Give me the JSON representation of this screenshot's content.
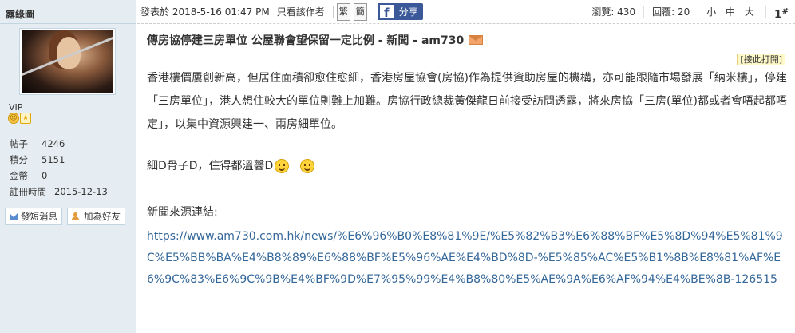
{
  "user": {
    "name": "露綠圖",
    "group": "VIP",
    "stats": [
      {
        "label": "帖子",
        "value": "4246"
      },
      {
        "label": "積分",
        "value": "5151"
      },
      {
        "label": "金幣",
        "value": "0"
      },
      {
        "label": "註冊時間",
        "value": "2015-12-13"
      }
    ],
    "buttons": {
      "message": "發短消息",
      "add_friend": "加為好友"
    }
  },
  "post_meta": {
    "posted": "發表於 2018-5-16 01:47 PM",
    "only_author": "只看該作者",
    "trad": "繁",
    "simp": "簡",
    "share": "分享",
    "share_logo": "f",
    "views": "瀏覽: 430",
    "replies": "回覆: 20",
    "font_sizes": "小 中 大",
    "floor_num": "1",
    "floor_mark": "#"
  },
  "post": {
    "title": "傳房協停建三房單位 公屋聯會望保留一定比例 - 新聞 - am730",
    "print": "[接此打開]",
    "paragraph": "香港樓價屢創新高，但居住面積卻愈住愈細，香港房屋協會(房協)作為提供資助房屋的機構，亦可能跟隨市場發展「納米樓」，停建「三房單位」，港人想住較大的單位則難上加難。房協行政總裁黃傑龍日前接受訪問透露，將來房協「三房(單位)都或者會唔起都唔定」，以集中資源興建一、兩房細單位。",
    "comment": "細D骨子D，住得都溫馨D",
    "source_label": "新聞來源連結:",
    "source_link": "https://www.am730.com.hk/news/%E6%96%B0%E8%81%9E/%E5%82%B3%E6%88%BF%E5%8D%94%E5%81%9C%E5%BB%BA%E4%B8%89%E6%88%BF%E5%96%AE%E4%BD%8D-%E5%85%AC%E5%B1%8B%E8%81%AF%E6%9C%83%E6%9C%9B%E4%BF%9D%E7%95%99%E4%B8%80%E5%AE%9A%E6%AF%94%E4%BE%8B-126515"
  },
  "colors": {
    "sidebar_bg": "#e5edf2",
    "link": "#336699",
    "facebook": "#3b5998"
  }
}
